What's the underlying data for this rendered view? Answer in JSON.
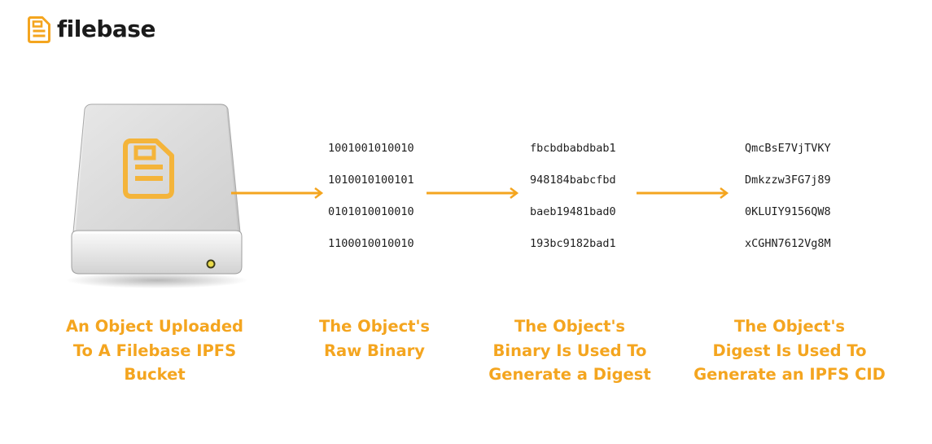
{
  "brand": {
    "name": "filebase",
    "accent_color": "#f4a51f",
    "logo_icon": "document-icon"
  },
  "drive": {
    "icon": "hard-drive-icon",
    "inner_icon": "document-icon"
  },
  "columns": {
    "binary": [
      "1001001010010",
      "1010010100101",
      "0101010010010",
      "1100010010010"
    ],
    "digest": [
      "fbcbdbabdbab1",
      "948184babcfbd",
      "baeb19481bad0",
      "193bc9182bad1"
    ],
    "cid": [
      "QmcBsE7VjTVKY",
      "Dmkzzw3FG7j89",
      "0KLUIY9156QW8",
      "xCGHN7612Vg8M"
    ]
  },
  "captions": {
    "object": [
      "An Object Uploaded",
      "To A Filebase IPFS",
      "Bucket"
    ],
    "binary": [
      "The Object's",
      "Raw Binary"
    ],
    "digest": [
      "The Object's",
      "Binary Is Used To",
      "Generate a Digest"
    ],
    "cid": [
      "The Object's",
      "Digest Is Used To",
      "Generate an IPFS CID"
    ]
  }
}
